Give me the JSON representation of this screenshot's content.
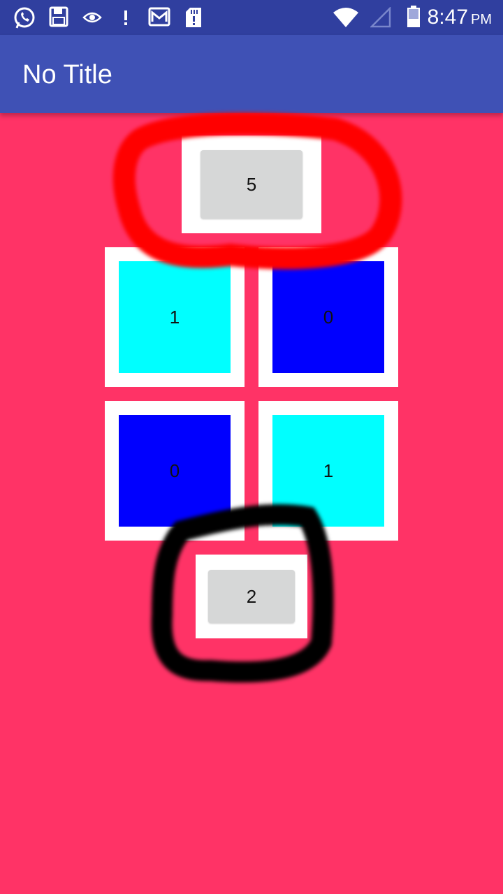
{
  "status_bar": {
    "icons": [
      "whatsapp-icon",
      "save-icon",
      "eye-icon",
      "alert-icon",
      "gmail-icon",
      "sd-card-icon",
      "wifi-icon",
      "signal-icon",
      "battery-icon"
    ],
    "time": "8:47",
    "ampm": "PM"
  },
  "app_bar": {
    "title": "No Title"
  },
  "top_button": {
    "label": "5"
  },
  "grid": {
    "tiles": [
      {
        "label": "1",
        "color": "#00FFFF"
      },
      {
        "label": "0",
        "color": "#0000FF"
      },
      {
        "label": "0",
        "color": "#0000FF"
      },
      {
        "label": "1",
        "color": "#00FFFF"
      }
    ]
  },
  "bottom_button": {
    "label": "2"
  },
  "colors": {
    "background": "#FF3366",
    "status_bar": "#303F9F",
    "app_bar": "#3F51B5",
    "button": "#D6D7D7",
    "red_annotation": "#FF0000",
    "black_annotation": "#000000"
  }
}
